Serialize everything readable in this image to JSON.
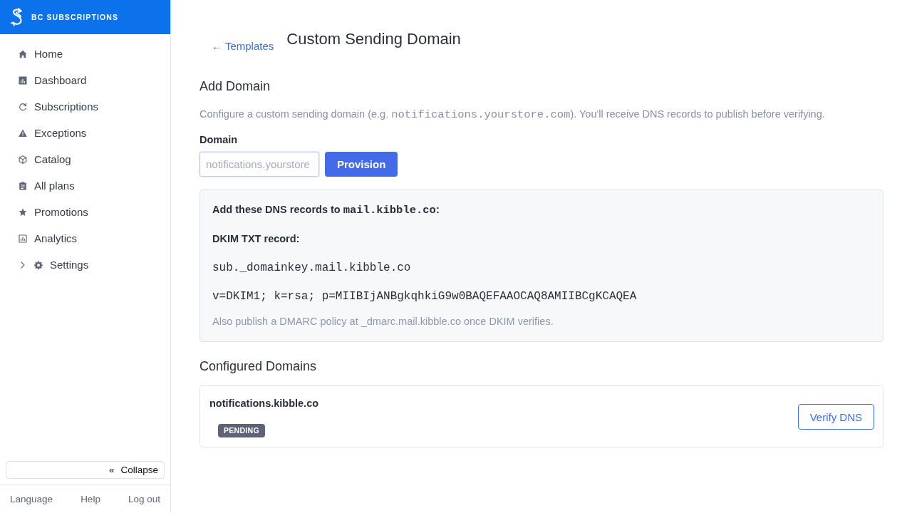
{
  "sidebar": {
    "brand": "BC SUBSCRIPTIONS",
    "nav": [
      {
        "label": "Home",
        "kind": "link",
        "selected": false
      },
      {
        "label": "Dashboard",
        "kind": "link",
        "selected": false
      },
      {
        "label": "Subscriptions",
        "kind": "link",
        "selected": false
      },
      {
        "label": "Exceptions",
        "kind": "link",
        "selected": false
      },
      {
        "label": "Catalog",
        "kind": "link",
        "selected": false
      },
      {
        "label": "All plans",
        "kind": "link",
        "selected": false
      },
      {
        "label": "Promotions",
        "kind": "link",
        "selected": false
      },
      {
        "label": "Analytics",
        "kind": "link",
        "selected": false
      },
      {
        "label": "Settings",
        "kind": "group",
        "selected": false,
        "expanded": false
      }
    ],
    "collapse": {
      "glyph": "«",
      "label": "Collapse"
    },
    "footer_links": [
      "Language",
      "Help",
      "Log out"
    ]
  },
  "page": {
    "back_link": "← Templates",
    "title": "Custom Sending Domain"
  },
  "add_domain": {
    "heading": "Add Domain",
    "description": [
      {
        "kind": "text",
        "text": "Configure a custom sending domain (e.g. "
      },
      {
        "kind": "code",
        "text": "notifications.yourstore.com"
      },
      {
        "kind": "text",
        "text": "). You'll receive DNS records to publish before verifying."
      }
    ],
    "field_label": "Domain",
    "field": {
      "placeholder": "notifications.yourstore"
    },
    "button": "Provision"
  },
  "dns_panel": {
    "intro": [
      {
        "kind": "text",
        "text": "Add these DNS records to "
      },
      {
        "kind": "code",
        "text": "mail.kibble.co"
      },
      {
        "kind": "text",
        "text": ":"
      }
    ],
    "record_title": "DKIM TXT record:",
    "record_lines": [
      "sub._domainkey.mail.kibble.co",
      "v=DKIM1; k=rsa; p=MIIBIjANBgkqhkiG9w0BAQEFAAOCAQ8AMIIBCgKCAQEA"
    ],
    "note": "Also publish a DMARC policy at _dmarc.mail.kibble.co once DKIM verifies."
  },
  "configured": {
    "heading": "Configured Domains",
    "domains": [
      {
        "name": "notifications.kibble.co",
        "status": "PENDING",
        "action": "Verify DNS"
      }
    ]
  }
}
